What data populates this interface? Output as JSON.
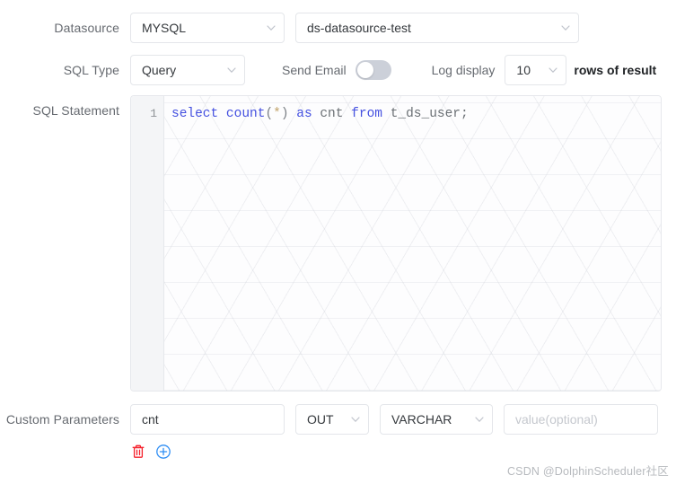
{
  "form": {
    "datasource": {
      "label": "Datasource",
      "type_value": "MYSQL",
      "name_value": "ds-datasource-test"
    },
    "sql_type": {
      "label": "SQL Type",
      "value": "Query"
    },
    "send_email": {
      "label": "Send Email",
      "state": "off"
    },
    "log_display": {
      "label": "Log display",
      "value": "10",
      "suffix": "rows of result"
    },
    "sql_statement": {
      "label": "SQL Statement",
      "line_number": "1",
      "code": "select count(*) as cnt from t_ds_user;",
      "tokens": [
        {
          "text": "select",
          "kind": "keyword"
        },
        {
          "text": " ",
          "kind": "plain"
        },
        {
          "text": "count",
          "kind": "function"
        },
        {
          "text": "(",
          "kind": "operator"
        },
        {
          "text": "*",
          "kind": "star"
        },
        {
          "text": ")",
          "kind": "operator"
        },
        {
          "text": " ",
          "kind": "plain"
        },
        {
          "text": "as",
          "kind": "keyword"
        },
        {
          "text": " ",
          "kind": "plain"
        },
        {
          "text": "cnt",
          "kind": "identifier"
        },
        {
          "text": " ",
          "kind": "plain"
        },
        {
          "text": "from",
          "kind": "keyword"
        },
        {
          "text": " ",
          "kind": "plain"
        },
        {
          "text": "t_ds_user;",
          "kind": "identifier"
        }
      ]
    },
    "custom_parameters": {
      "label": "Custom Parameters",
      "rows": [
        {
          "name_value": "cnt",
          "direction_value": "OUT",
          "data_type_value": "VARCHAR",
          "value_value": "",
          "value_placeholder": "value(optional)"
        }
      ],
      "delete_icon": "trash-icon",
      "add_icon": "plus-circle-icon"
    }
  },
  "icons": {
    "chevron_down": "chevron-down-icon",
    "trash": "trash-icon",
    "plus_circle": "plus-circle-icon"
  },
  "colors": {
    "keyword": "#4450e0",
    "identifier": "#6b7075",
    "star": "#c2a36b",
    "delete": "#f5222d",
    "add": "#2f8ef4",
    "border": "#e4e6ea",
    "label_text": "#666a70"
  },
  "watermark": {
    "text": "CSDN @DolphinScheduler社区"
  }
}
